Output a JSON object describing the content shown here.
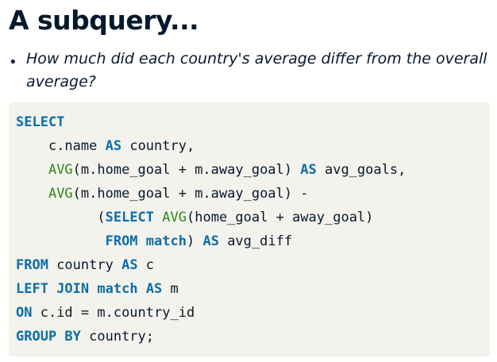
{
  "slide": {
    "title": "A subquery...",
    "bullet_symbol": "•",
    "bullet": "How much did each country's average differ from the overall average?"
  },
  "code": {
    "colors": {
      "keyword": "#0a6ea8",
      "function": "#2c8a1e",
      "text": "#05192d",
      "background": "#f4f2ec"
    },
    "lines": [
      {
        "indent": "",
        "tokens": [
          {
            "t": "kw",
            "v": "SELECT"
          }
        ]
      },
      {
        "indent": "    ",
        "tokens": [
          {
            "t": "tx",
            "v": "c.name "
          },
          {
            "t": "kw",
            "v": "AS"
          },
          {
            "t": "tx",
            "v": " country,"
          }
        ]
      },
      {
        "indent": "    ",
        "tokens": [
          {
            "t": "fn",
            "v": "AVG"
          },
          {
            "t": "tx",
            "v": "(m.home_goal + m.away_goal) "
          },
          {
            "t": "kw",
            "v": "AS"
          },
          {
            "t": "tx",
            "v": " avg_goals,"
          }
        ]
      },
      {
        "indent": "    ",
        "tokens": [
          {
            "t": "fn",
            "v": "AVG"
          },
          {
            "t": "tx",
            "v": "(m.home_goal + m.away_goal) -"
          }
        ]
      },
      {
        "indent": "          ",
        "tokens": [
          {
            "t": "tx",
            "v": "("
          },
          {
            "t": "kw",
            "v": "SELECT"
          },
          {
            "t": "tx",
            "v": " "
          },
          {
            "t": "fn",
            "v": "AVG"
          },
          {
            "t": "tx",
            "v": "(home_goal + away_goal)"
          }
        ]
      },
      {
        "indent": "           ",
        "tokens": [
          {
            "t": "kw",
            "v": "FROM"
          },
          {
            "t": "tx",
            "v": " "
          },
          {
            "t": "kw",
            "v": "match"
          },
          {
            "t": "tx",
            "v": ") "
          },
          {
            "t": "kw",
            "v": "AS"
          },
          {
            "t": "tx",
            "v": " avg_diff"
          }
        ]
      },
      {
        "indent": "",
        "tokens": [
          {
            "t": "kw",
            "v": "FROM"
          },
          {
            "t": "tx",
            "v": " country "
          },
          {
            "t": "kw",
            "v": "AS"
          },
          {
            "t": "tx",
            "v": " c"
          }
        ]
      },
      {
        "indent": "",
        "tokens": [
          {
            "t": "kw",
            "v": "LEFT JOIN"
          },
          {
            "t": "tx",
            "v": " "
          },
          {
            "t": "kw",
            "v": "match"
          },
          {
            "t": "tx",
            "v": " "
          },
          {
            "t": "kw",
            "v": "AS"
          },
          {
            "t": "tx",
            "v": " m"
          }
        ]
      },
      {
        "indent": "",
        "tokens": [
          {
            "t": "kw",
            "v": "ON"
          },
          {
            "t": "tx",
            "v": " c.id = m.country_id"
          }
        ]
      },
      {
        "indent": "",
        "tokens": [
          {
            "t": "kw",
            "v": "GROUP BY"
          },
          {
            "t": "tx",
            "v": " country;"
          }
        ]
      }
    ]
  }
}
